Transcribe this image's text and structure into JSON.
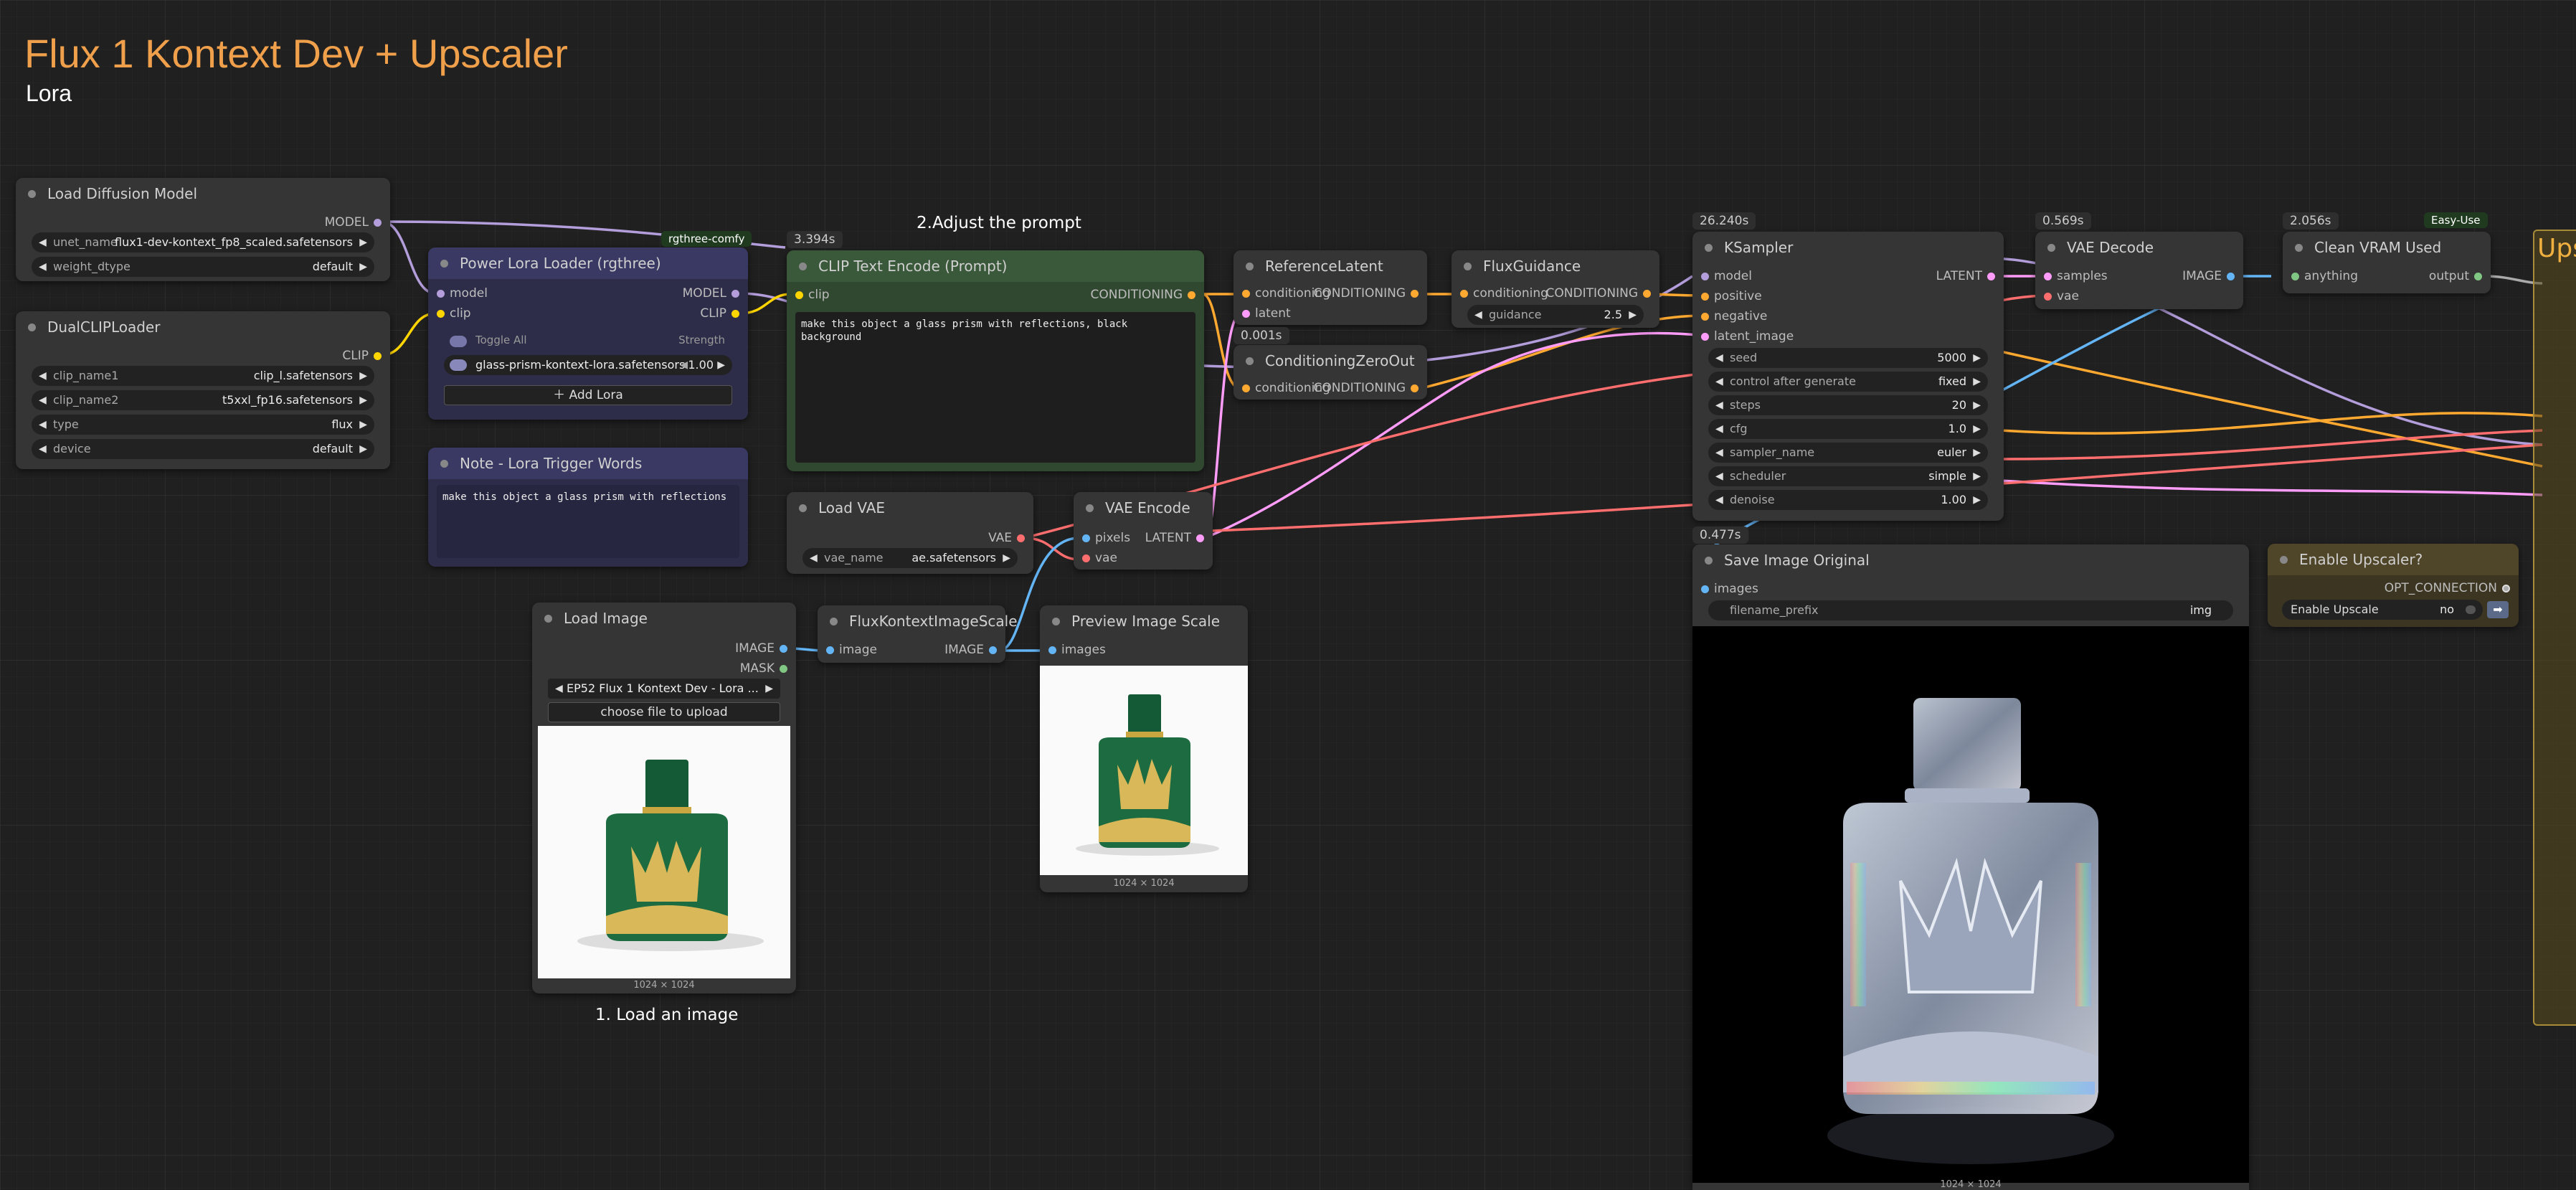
{
  "title": "Flux 1 Kontext Dev + Upscaler",
  "subtitle": "Lora",
  "labels": {
    "adjust": "2.Adjust the prompt",
    "load_image": "1. Load an image",
    "rgthree": "rgthree-comfy",
    "easy_use": "Easy-Use",
    "upscale": "Ups"
  },
  "timings": {
    "clip": "3.394s",
    "ref": "0.001s",
    "ksampler": "26.240s",
    "vaedec": "0.569s",
    "vram": "2.056s",
    "save": "0.477s"
  },
  "colors": {
    "model": "#b39ddb",
    "clip": "#ffd500",
    "cond": "#ffa931",
    "latent": "#ff9cf9",
    "vae": "#ff6e6e",
    "image": "#64b5f6",
    "mask": "#81c784",
    "any": "#aaaaaa"
  },
  "n_load_diff": {
    "title": "Load Diffusion Model",
    "out": "MODEL",
    "unet_name_l": "unet_name",
    "unet_name_v": "flux1-dev-kontext_fp8_scaled.safetensors",
    "weight_l": "weight_dtype",
    "weight_v": "default"
  },
  "n_dualclip": {
    "title": "DualCLIPLoader",
    "out": "CLIP",
    "c1_l": "clip_name1",
    "c1_v": "clip_l.safetensors",
    "c2_l": "clip_name2",
    "c2_v": "t5xxl_fp16.safetensors",
    "type_l": "type",
    "type_v": "flux",
    "dev_l": "device",
    "dev_v": "default"
  },
  "n_lora": {
    "title": "Power Lora Loader (rgthree)",
    "in1": "model",
    "in2": "clip",
    "out1": "MODEL",
    "out2": "CLIP",
    "toggle": "Toggle All",
    "strength": "Strength",
    "lora_name": "glass-prism-kontext-lora.safetensors",
    "lora_val": "1.00",
    "add": "Add Lora"
  },
  "n_note": {
    "title": "Note - Lora Trigger Words",
    "text": "make this object a glass prism with reflections"
  },
  "n_clip": {
    "title": "CLIP Text Encode (Prompt)",
    "in": "clip",
    "out": "CONDITIONING",
    "text": "make this object a glass prism with reflections, black background"
  },
  "n_ref": {
    "title": "ReferenceLatent",
    "in1": "conditioning",
    "in2": "latent",
    "out": "CONDITIONING"
  },
  "n_czero": {
    "title": "ConditioningZeroOut",
    "in": "conditioning",
    "out": "CONDITIONING"
  },
  "n_guid": {
    "title": "FluxGuidance",
    "in": "conditioning",
    "out": "CONDITIONING",
    "g_l": "guidance",
    "g_v": "2.5"
  },
  "n_ks": {
    "title": "KSampler",
    "in1": "model",
    "in2": "positive",
    "in3": "negative",
    "in4": "latent_image",
    "out": "LATENT",
    "seed_l": "seed",
    "seed_v": "5000",
    "cag_l": "control after generate",
    "cag_v": "fixed",
    "steps_l": "steps",
    "steps_v": "20",
    "cfg_l": "cfg",
    "cfg_v": "1.0",
    "sam_l": "sampler_name",
    "sam_v": "euler",
    "sch_l": "scheduler",
    "sch_v": "simple",
    "den_l": "denoise",
    "den_v": "1.00"
  },
  "n_vaedec": {
    "title": "VAE Decode",
    "in1": "samples",
    "in2": "vae",
    "out": "IMAGE"
  },
  "n_vram": {
    "title": "Clean VRAM Used",
    "in": "anything",
    "out": "output"
  },
  "n_loadvae": {
    "title": "Load VAE",
    "out": "VAE",
    "name_l": "vae_name",
    "name_v": "ae.safetensors"
  },
  "n_vaeenc": {
    "title": "VAE Encode",
    "in1": "pixels",
    "in2": "vae",
    "out": "LATENT"
  },
  "n_loadimg": {
    "title": "Load Image",
    "out1": "IMAGE",
    "out2": "MASK",
    "file": "EP52 Flux 1 Kontext Dev - Lora ...",
    "upload": "choose file to upload",
    "size": "1024 × 1024"
  },
  "n_scale": {
    "title": "FluxKontextImageScale",
    "in": "image",
    "out": "IMAGE"
  },
  "n_preview": {
    "title": "Preview Image Scale",
    "in": "images",
    "size": "1024 × 1024"
  },
  "n_save": {
    "title": "Save Image Original",
    "in": "images",
    "prefix_l": "filename_prefix",
    "prefix_v": "img",
    "size": "1024 × 1024"
  },
  "n_enable": {
    "title": "Enable Upscaler?",
    "out": "OPT_CONNECTION",
    "l": "Enable Upscale",
    "v": "no"
  }
}
